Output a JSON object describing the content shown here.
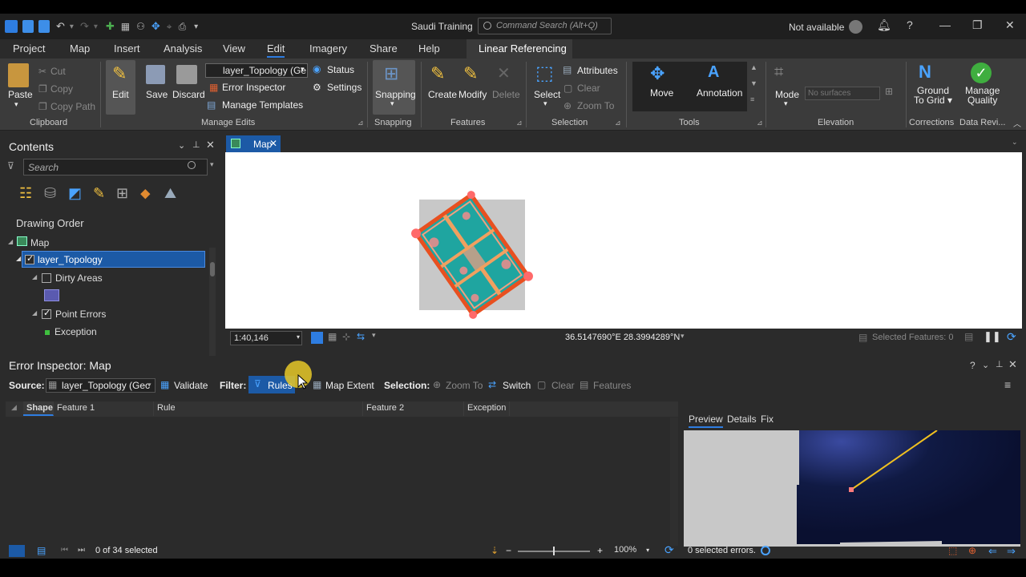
{
  "window": {
    "title": "Saudi Training",
    "command_search_placeholder": "Command Search (Alt+Q)",
    "sign_in_status": "Not available"
  },
  "menu": [
    "Project",
    "Map",
    "Insert",
    "Analysis",
    "View",
    "Edit",
    "Imagery",
    "Share",
    "Help"
  ],
  "menu_context_tab": "Linear Referencing",
  "ribbon": {
    "clipboard": {
      "label": "Clipboard",
      "paste": "Paste",
      "cut": "Cut",
      "copy": "Copy",
      "copy_path": "Copy Path"
    },
    "manage_edits": {
      "label": "Manage Edits",
      "edit": "Edit",
      "save": "Save",
      "discard": "Discard",
      "layer_select": "layer_Topology (Ge",
      "status": "Status",
      "error_inspector": "Error Inspector",
      "settings": "Settings",
      "manage_templates": "Manage Templates"
    },
    "snapping": {
      "label": "Snapping",
      "snapping": "Snapping"
    },
    "features": {
      "label": "Features",
      "create": "Create",
      "modify": "Modify",
      "delete": "Delete"
    },
    "selection": {
      "label": "Selection",
      "select": "Select",
      "attributes": "Attributes",
      "clear": "Clear",
      "zoom_to": "Zoom To"
    },
    "tools": {
      "label": "Tools",
      "move": "Move",
      "annotation": "Annotation"
    },
    "elevation": {
      "label": "Elevation",
      "mode": "Mode",
      "surface_placeholder": "No surfaces"
    },
    "corrections": {
      "label": "Corrections",
      "ground_to_grid_line1": "Ground",
      "ground_to_grid_line2": "To Grid ▾"
    },
    "data_reviewer": {
      "label": "Data Revi...",
      "manage_quality_line1": "Manage",
      "manage_quality_line2": "Quality"
    }
  },
  "contents": {
    "title": "Contents",
    "search_placeholder": "Search",
    "section": "Drawing Order",
    "tree": [
      "Map",
      "layer_Topology",
      "Dirty Areas",
      "Point Errors",
      "Exception"
    ]
  },
  "map": {
    "tab_label": "Map",
    "scale": "1:40,146",
    "coordinates": "36.5147690°E 28.3994289°N",
    "selected_features": "Selected Features: 0"
  },
  "error_inspector": {
    "title": "Error Inspector: Map",
    "source_label": "Source:",
    "source_value": "layer_Topology (Gec",
    "validate": "Validate",
    "filter_label": "Filter:",
    "rules": "Rules",
    "map_extent": "Map Extent",
    "selection_label": "Selection:",
    "zoom_to": "Zoom To",
    "switch": "Switch",
    "clear": "Clear",
    "features": "Features",
    "columns": [
      "Shape",
      "Feature 1",
      "Rule",
      "Feature 2",
      "Exception"
    ],
    "rows": [],
    "preview_tabs": [
      "Preview",
      "Details",
      "Fix"
    ],
    "selected_count": "0 of 34 selected",
    "zoom_level": "100%",
    "selected_errors": "0 selected errors."
  },
  "colors": {
    "accent": "#2e7de1",
    "selection": "#1c5aa6",
    "error_point": "#ff7b7b",
    "topology_line": "#e85020",
    "preview_line": "#f0c020"
  }
}
